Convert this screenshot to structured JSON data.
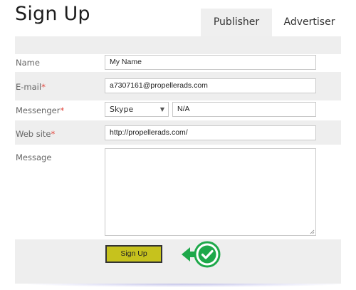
{
  "page": {
    "title": "Sign Up"
  },
  "tabs": [
    {
      "label": "Publisher",
      "active": true
    },
    {
      "label": "Advertiser",
      "active": false
    }
  ],
  "form": {
    "name": {
      "label": "Name",
      "value": "My Name"
    },
    "email": {
      "label": "E-mail",
      "required_mark": "*",
      "value": "a7307161@propellerads.com"
    },
    "messenger": {
      "label": "Messenger",
      "required_mark": "*",
      "selected": "Skype",
      "value": "N/A"
    },
    "website": {
      "label": "Web site",
      "required_mark": "*",
      "value": "http://propellerads.com/"
    },
    "message": {
      "label": "Message",
      "value": ""
    },
    "submit_label": "Sign Up"
  },
  "colors": {
    "submit_bg": "#c6c21d",
    "required": "#e2453c",
    "check_green": "#1ea84a"
  },
  "icons": {
    "pointer": "check-arrow-icon",
    "dropdown": "chevron-down-icon"
  }
}
